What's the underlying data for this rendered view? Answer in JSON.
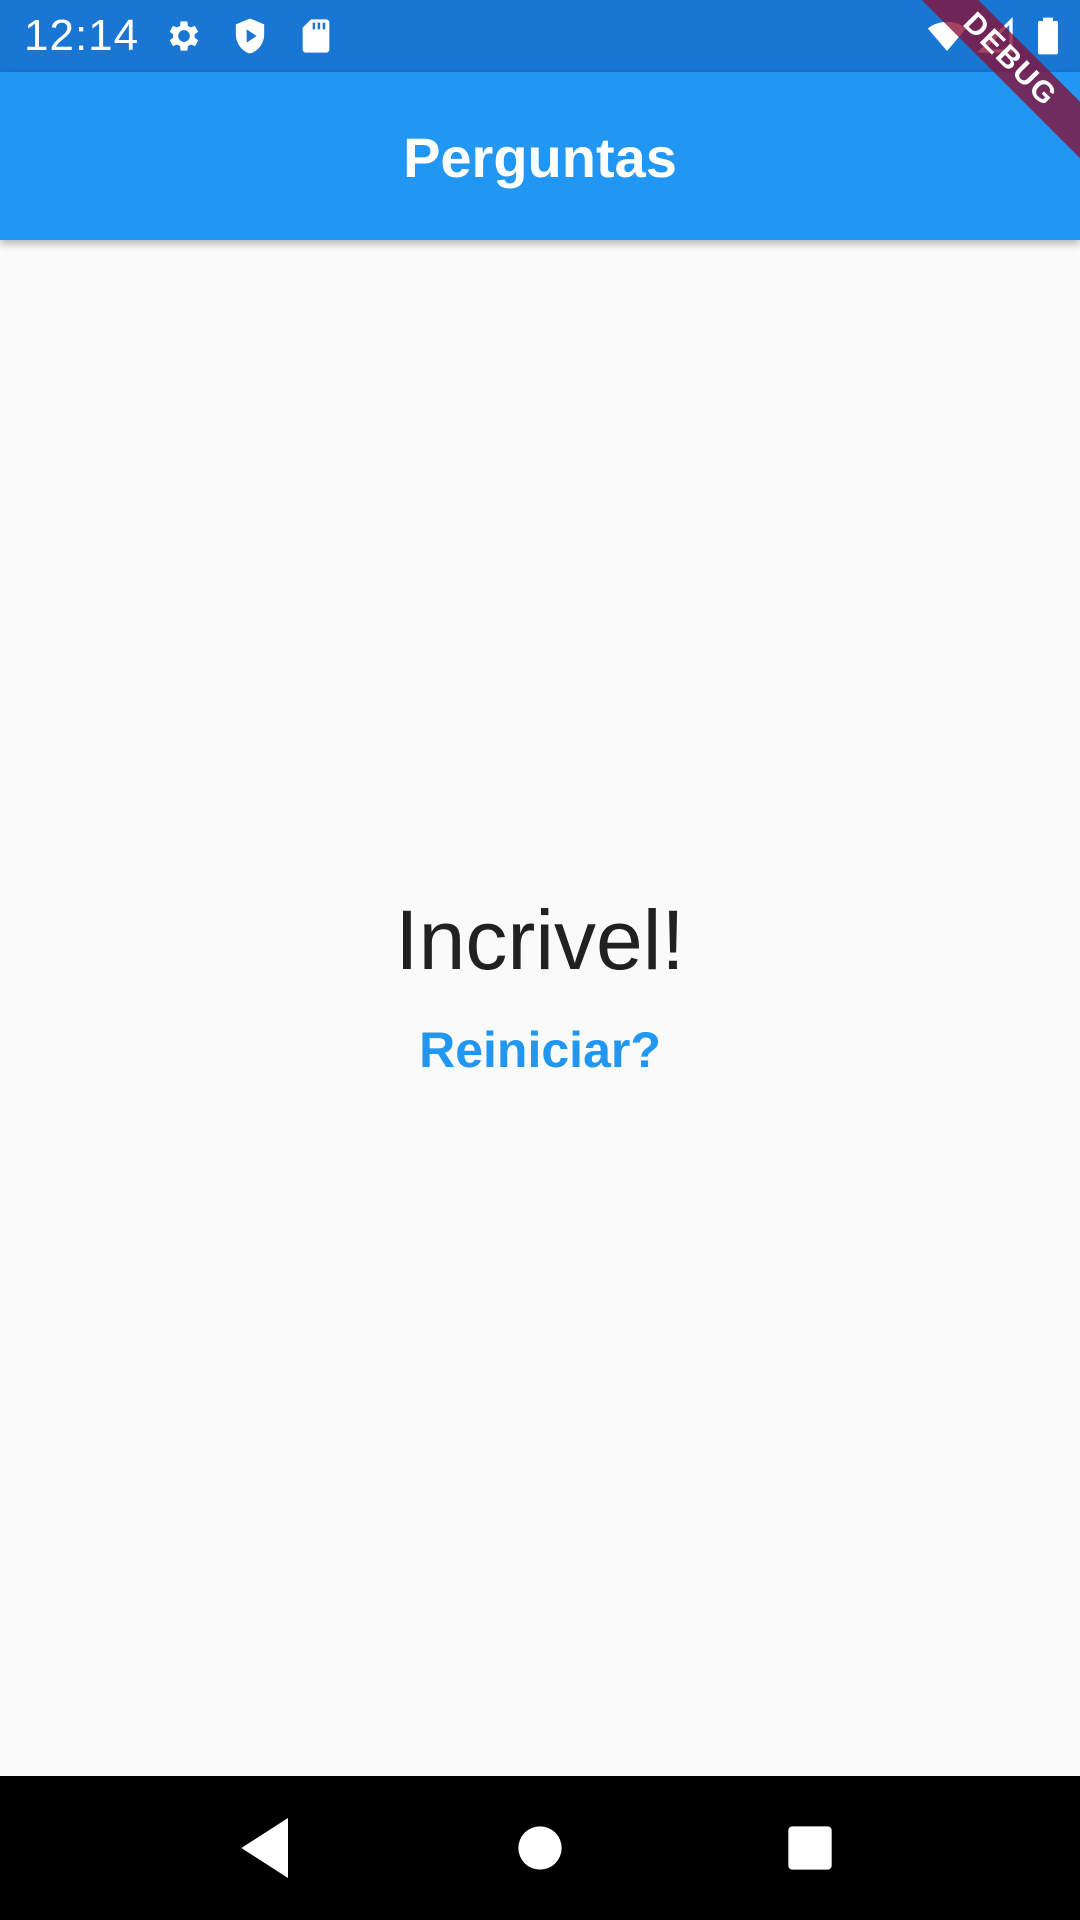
{
  "status_bar": {
    "time": "12:14",
    "icons_left": [
      "gear-icon",
      "shield-play-icon",
      "sd-card-icon"
    ],
    "icons_right": [
      "wifi-icon",
      "cell-signal-icon",
      "battery-icon"
    ]
  },
  "app_bar": {
    "title": "Perguntas",
    "color": "#2196f3"
  },
  "debug_banner": {
    "label": "DEBUG"
  },
  "result": {
    "message": "Incrivel!",
    "restart_label": "Reiniciar?"
  },
  "navigation": {
    "buttons": [
      "back-icon",
      "home-icon",
      "recents-icon"
    ]
  },
  "colors": {
    "status_bar": "#1976d2",
    "primary": "#2196f3",
    "background": "#fafafa",
    "text": "#212121"
  }
}
